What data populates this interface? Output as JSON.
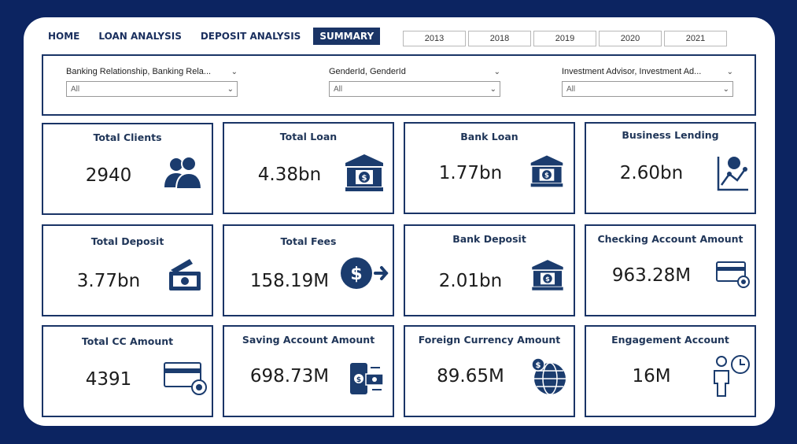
{
  "nav": {
    "items": [
      {
        "label": "HOME",
        "active": false
      },
      {
        "label": "LOAN ANALYSIS",
        "active": false
      },
      {
        "label": "DEPOSIT ANALYSIS",
        "active": false
      },
      {
        "label": "SUMMARY",
        "active": true
      }
    ]
  },
  "years": [
    "2013",
    "2018",
    "2019",
    "2020",
    "2021"
  ],
  "filters": [
    {
      "label": "Banking Relationship, Banking Rela...",
      "value": "All"
    },
    {
      "label": "GenderId, GenderId",
      "value": "All"
    },
    {
      "label": "Investment Advisor, Investment Ad...",
      "value": "All"
    }
  ],
  "cards": [
    {
      "title": "Total Clients",
      "value": "2940",
      "icon": "people-icon"
    },
    {
      "title": "Total Loan",
      "value": "4.38bn",
      "icon": "bank-icon"
    },
    {
      "title": "Bank Loan",
      "value": "1.77bn",
      "icon": "bank-icon"
    },
    {
      "title": "Business Lending",
      "value": "2.60bn",
      "icon": "chart-growth-icon"
    },
    {
      "title": "Total Deposit",
      "value": "3.77bn",
      "icon": "cash-deposit-icon"
    },
    {
      "title": "Total Fees",
      "value": "158.19M",
      "icon": "dollar-transfer-icon"
    },
    {
      "title": "Bank Deposit",
      "value": "2.01bn",
      "icon": "bank-icon"
    },
    {
      "title": "Checking Account Amount",
      "value": "963.28M",
      "icon": "card-settings-icon"
    },
    {
      "title": "Total CC Amount",
      "value": "4391",
      "icon": "card-settings-icon"
    },
    {
      "title": "Saving Account Amount",
      "value": "698.73M",
      "icon": "mobile-payment-icon"
    },
    {
      "title": "Foreign Currency Amount",
      "value": "89.65M",
      "icon": "globe-dollar-icon"
    },
    {
      "title": "Engagement Account",
      "value": "16M",
      "icon": "person-clock-icon"
    }
  ],
  "colors": {
    "background": "#0c2461",
    "accent": "#1a3466",
    "icon": "#1b3c6e"
  }
}
